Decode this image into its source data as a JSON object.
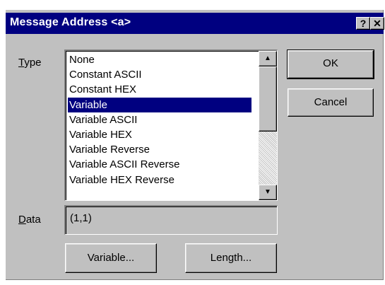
{
  "window": {
    "title": "Message Address <a>",
    "help_button": "?",
    "close_button": "✕"
  },
  "type_label": {
    "mnemonic": "T",
    "rest": "ype"
  },
  "data_label": {
    "mnemonic": "D",
    "rest": "ata"
  },
  "type_list": {
    "items": [
      "None",
      "Constant ASCII",
      "Constant HEX",
      "Variable",
      "Variable ASCII",
      "Variable HEX",
      "Variable Reverse",
      "Variable ASCII Reverse",
      "Variable HEX Reverse"
    ],
    "selected": "Variable"
  },
  "data_field": {
    "value": "(1,1)"
  },
  "buttons": {
    "ok": "OK",
    "cancel": "Cancel",
    "variable": "Variable...",
    "length": "Length..."
  },
  "scrollbar": {
    "up_arrow": "▲",
    "down_arrow": "▼"
  },
  "colors": {
    "title_bar": "#000080",
    "dialog_face": "#c0c0c0",
    "selection": "#000080"
  }
}
